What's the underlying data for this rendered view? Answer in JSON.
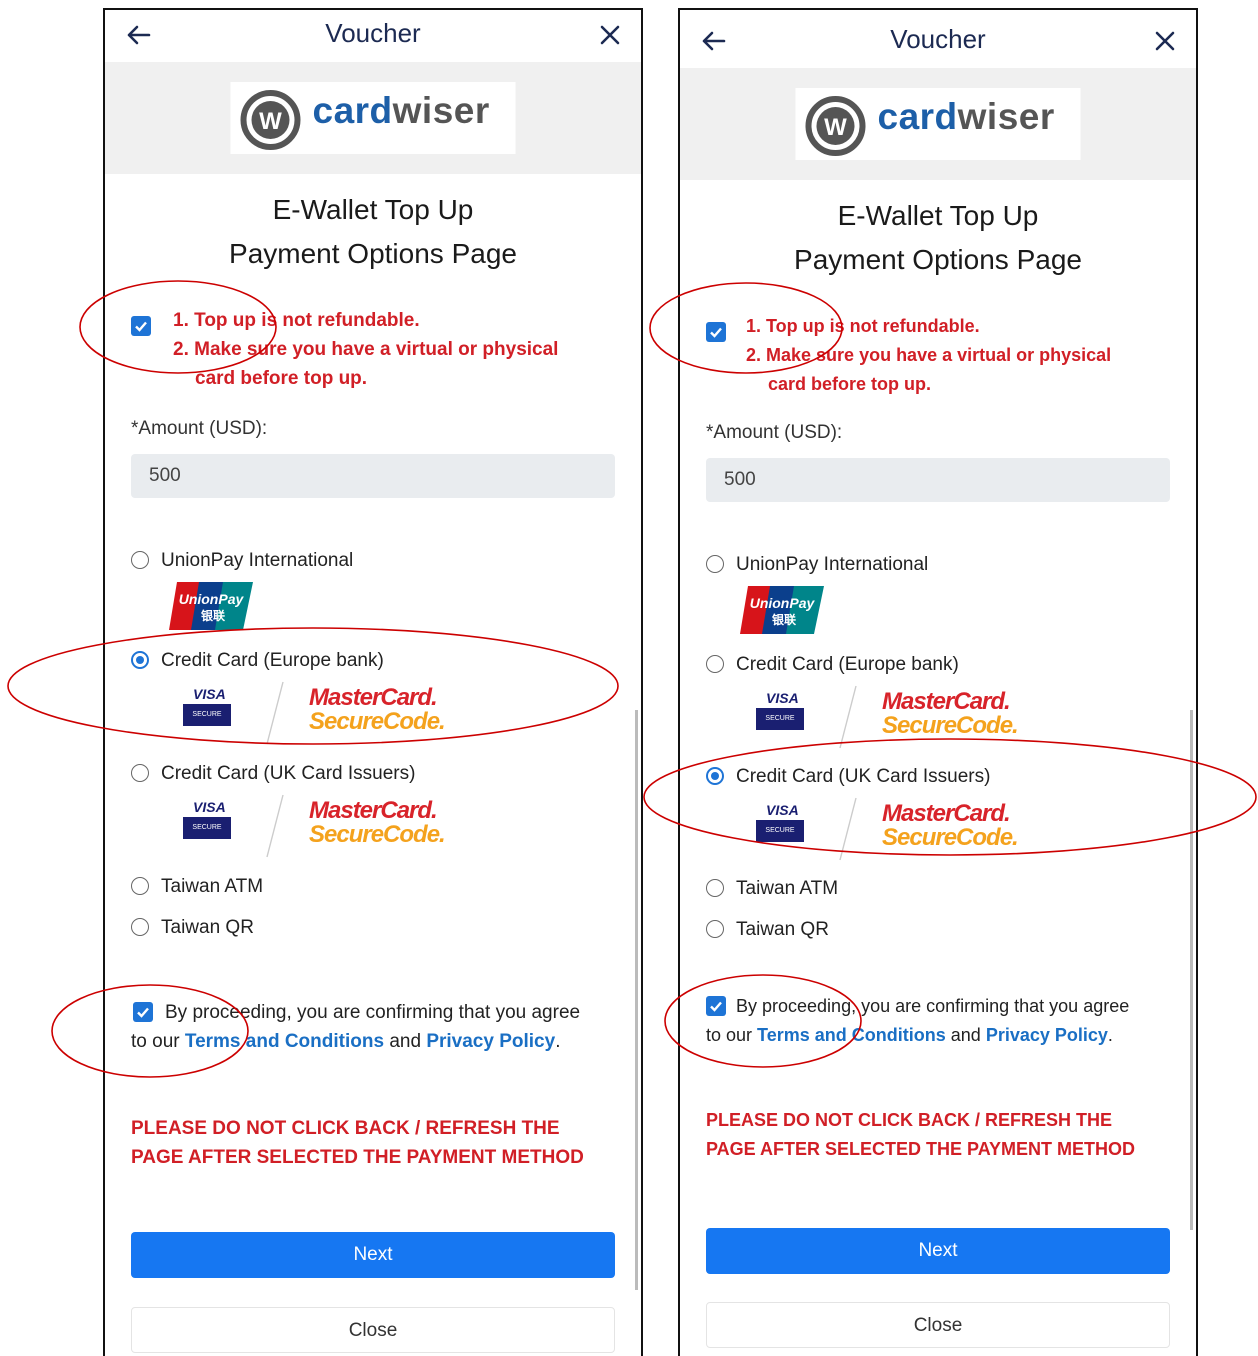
{
  "header": {
    "title": "Voucher"
  },
  "logo": {
    "part1": "card",
    "part2": "wiser"
  },
  "page": {
    "title_line1": "E-Wallet Top Up",
    "title_line2": "Payment Options Page"
  },
  "notice": {
    "line1": "1. Top up is not refundable.",
    "line2": "2. Make sure you have a virtual or physical",
    "line3": "card before top up."
  },
  "amount": {
    "label": "*Amount (USD):",
    "value": "500"
  },
  "payment_options": {
    "unionpay": "UnionPay International",
    "credit_eu": "Credit Card (Europe bank)",
    "credit_uk": "Credit Card (UK Card Issuers)",
    "taiwan_atm": "Taiwan ATM",
    "taiwan_qr": "Taiwan QR"
  },
  "card_logos": {
    "visa": "VISA",
    "visa_secure": "SECURE",
    "mc_line1": "MasterCard.",
    "mc_line2": "SecureCode.",
    "unionpay_en": "UnionPay",
    "unionpay_cn": "银联"
  },
  "agreement": {
    "text1": "By proceeding, you are confirming that you agree",
    "text2": "to our",
    "terms": "Terms and Conditions",
    "and": "and",
    "privacy": "Privacy Policy",
    "period": "."
  },
  "warning": {
    "line1": "PLEASE DO NOT CLICK BACK / REFRESH THE",
    "line2": "PAGE AFTER SELECTED THE PAYMENT METHOD"
  },
  "buttons": {
    "next": "Next",
    "close": "Close"
  },
  "screens": [
    {
      "selected_option": "credit_eu",
      "notice_checked": true,
      "agree_checked": true
    },
    {
      "selected_option": "credit_uk",
      "notice_checked": true,
      "agree_checked": true
    }
  ],
  "colors": {
    "brand_blue": "#1d5fa8",
    "accent_blue": "#1677f2",
    "warning_red": "#d11f26",
    "annotation_red": "#cc0000"
  },
  "icons": [
    "back-arrow-icon",
    "close-icon",
    "checkbox-checked-icon",
    "radio-icon",
    "unionpay-logo",
    "visa-secure-logo",
    "mastercard-securecode-logo"
  ]
}
